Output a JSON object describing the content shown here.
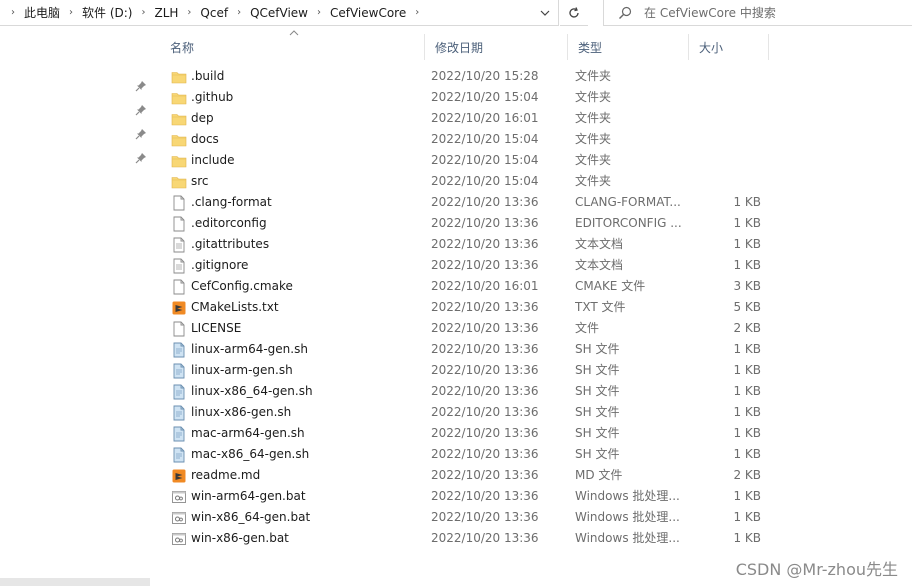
{
  "address": {
    "crumbs": [
      "此电脑",
      "软件 (D:)",
      "ZLH",
      "Qcef",
      "QCefView",
      "CefViewCore"
    ]
  },
  "search": {
    "placeholder": "在 CefViewCore 中搜索"
  },
  "columns": {
    "name": "名称",
    "date": "修改日期",
    "type": "类型",
    "size": "大小"
  },
  "files": [
    {
      "name": ".build",
      "date": "2022/10/20 15:28",
      "type": "文件夹",
      "size": "",
      "icon": "folder-icon"
    },
    {
      "name": ".github",
      "date": "2022/10/20 15:04",
      "type": "文件夹",
      "size": "",
      "icon": "folder-icon"
    },
    {
      "name": "dep",
      "date": "2022/10/20 16:01",
      "type": "文件夹",
      "size": "",
      "icon": "folder-icon"
    },
    {
      "name": "docs",
      "date": "2022/10/20 15:04",
      "type": "文件夹",
      "size": "",
      "icon": "folder-icon"
    },
    {
      "name": "include",
      "date": "2022/10/20 15:04",
      "type": "文件夹",
      "size": "",
      "icon": "folder-icon"
    },
    {
      "name": "src",
      "date": "2022/10/20 15:04",
      "type": "文件夹",
      "size": "",
      "icon": "folder-icon"
    },
    {
      "name": ".clang-format",
      "date": "2022/10/20 13:36",
      "type": "CLANG-FORMAT...",
      "size": "1 KB",
      "icon": "file-icon"
    },
    {
      "name": ".editorconfig",
      "date": "2022/10/20 13:36",
      "type": "EDITORCONFIG ...",
      "size": "1 KB",
      "icon": "file-icon"
    },
    {
      "name": ".gitattributes",
      "date": "2022/10/20 13:36",
      "type": "文本文档",
      "size": "1 KB",
      "icon": "text-file-icon"
    },
    {
      "name": ".gitignore",
      "date": "2022/10/20 13:36",
      "type": "文本文档",
      "size": "1 KB",
      "icon": "text-file-icon"
    },
    {
      "name": "CefConfig.cmake",
      "date": "2022/10/20 16:01",
      "type": "CMAKE 文件",
      "size": "3 KB",
      "icon": "file-icon"
    },
    {
      "name": "CMakeLists.txt",
      "date": "2022/10/20 13:36",
      "type": "TXT 文件",
      "size": "5 KB",
      "icon": "sublime-file-icon"
    },
    {
      "name": "LICENSE",
      "date": "2022/10/20 13:36",
      "type": "文件",
      "size": "2 KB",
      "icon": "file-icon"
    },
    {
      "name": "linux-arm64-gen.sh",
      "date": "2022/10/20 13:36",
      "type": "SH 文件",
      "size": "1 KB",
      "icon": "script-file-icon"
    },
    {
      "name": "linux-arm-gen.sh",
      "date": "2022/10/20 13:36",
      "type": "SH 文件",
      "size": "1 KB",
      "icon": "script-file-icon"
    },
    {
      "name": "linux-x86_64-gen.sh",
      "date": "2022/10/20 13:36",
      "type": "SH 文件",
      "size": "1 KB",
      "icon": "script-file-icon"
    },
    {
      "name": "linux-x86-gen.sh",
      "date": "2022/10/20 13:36",
      "type": "SH 文件",
      "size": "1 KB",
      "icon": "script-file-icon"
    },
    {
      "name": "mac-arm64-gen.sh",
      "date": "2022/10/20 13:36",
      "type": "SH 文件",
      "size": "1 KB",
      "icon": "script-file-icon"
    },
    {
      "name": "mac-x86_64-gen.sh",
      "date": "2022/10/20 13:36",
      "type": "SH 文件",
      "size": "1 KB",
      "icon": "script-file-icon"
    },
    {
      "name": "readme.md",
      "date": "2022/10/20 13:36",
      "type": "MD 文件",
      "size": "2 KB",
      "icon": "sublime-file-icon"
    },
    {
      "name": "win-arm64-gen.bat",
      "date": "2022/10/20 13:36",
      "type": "Windows 批处理...",
      "size": "1 KB",
      "icon": "batch-file-icon"
    },
    {
      "name": "win-x86_64-gen.bat",
      "date": "2022/10/20 13:36",
      "type": "Windows 批处理...",
      "size": "1 KB",
      "icon": "batch-file-icon"
    },
    {
      "name": "win-x86-gen.bat",
      "date": "2022/10/20 13:36",
      "type": "Windows 批处理...",
      "size": "1 KB",
      "icon": "batch-file-icon"
    }
  ],
  "watermark": "CSDN @Mr-zhou先生",
  "colors": {
    "folder": "#f8d775",
    "sublime": "#f08a24",
    "header_text": "#4c607a"
  }
}
